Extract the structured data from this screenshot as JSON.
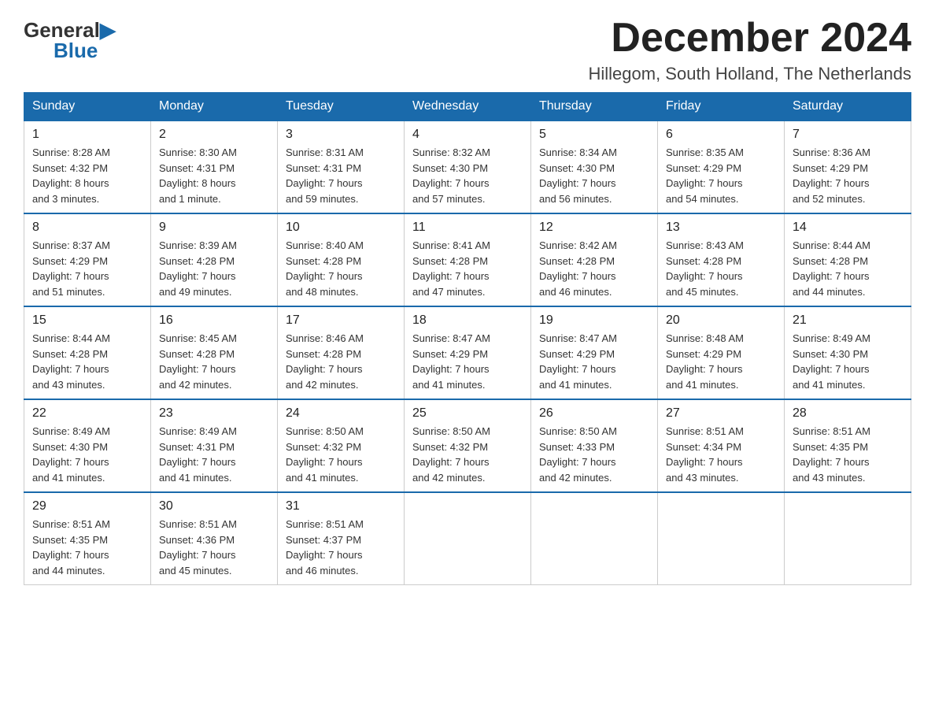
{
  "header": {
    "logo_general": "General",
    "logo_blue": "Blue",
    "month_year": "December 2024",
    "location": "Hillegom, South Holland, The Netherlands"
  },
  "weekdays": [
    "Sunday",
    "Monday",
    "Tuesday",
    "Wednesday",
    "Thursday",
    "Friday",
    "Saturday"
  ],
  "weeks": [
    [
      {
        "day": "1",
        "sunrise": "8:28 AM",
        "sunset": "4:32 PM",
        "daylight": "8 hours and 3 minutes."
      },
      {
        "day": "2",
        "sunrise": "8:30 AM",
        "sunset": "4:31 PM",
        "daylight": "8 hours and 1 minute."
      },
      {
        "day": "3",
        "sunrise": "8:31 AM",
        "sunset": "4:31 PM",
        "daylight": "7 hours and 59 minutes."
      },
      {
        "day": "4",
        "sunrise": "8:32 AM",
        "sunset": "4:30 PM",
        "daylight": "7 hours and 57 minutes."
      },
      {
        "day": "5",
        "sunrise": "8:34 AM",
        "sunset": "4:30 PM",
        "daylight": "7 hours and 56 minutes."
      },
      {
        "day": "6",
        "sunrise": "8:35 AM",
        "sunset": "4:29 PM",
        "daylight": "7 hours and 54 minutes."
      },
      {
        "day": "7",
        "sunrise": "8:36 AM",
        "sunset": "4:29 PM",
        "daylight": "7 hours and 52 minutes."
      }
    ],
    [
      {
        "day": "8",
        "sunrise": "8:37 AM",
        "sunset": "4:29 PM",
        "daylight": "7 hours and 51 minutes."
      },
      {
        "day": "9",
        "sunrise": "8:39 AM",
        "sunset": "4:28 PM",
        "daylight": "7 hours and 49 minutes."
      },
      {
        "day": "10",
        "sunrise": "8:40 AM",
        "sunset": "4:28 PM",
        "daylight": "7 hours and 48 minutes."
      },
      {
        "day": "11",
        "sunrise": "8:41 AM",
        "sunset": "4:28 PM",
        "daylight": "7 hours and 47 minutes."
      },
      {
        "day": "12",
        "sunrise": "8:42 AM",
        "sunset": "4:28 PM",
        "daylight": "7 hours and 46 minutes."
      },
      {
        "day": "13",
        "sunrise": "8:43 AM",
        "sunset": "4:28 PM",
        "daylight": "7 hours and 45 minutes."
      },
      {
        "day": "14",
        "sunrise": "8:44 AM",
        "sunset": "4:28 PM",
        "daylight": "7 hours and 44 minutes."
      }
    ],
    [
      {
        "day": "15",
        "sunrise": "8:44 AM",
        "sunset": "4:28 PM",
        "daylight": "7 hours and 43 minutes."
      },
      {
        "day": "16",
        "sunrise": "8:45 AM",
        "sunset": "4:28 PM",
        "daylight": "7 hours and 42 minutes."
      },
      {
        "day": "17",
        "sunrise": "8:46 AM",
        "sunset": "4:28 PM",
        "daylight": "7 hours and 42 minutes."
      },
      {
        "day": "18",
        "sunrise": "8:47 AM",
        "sunset": "4:29 PM",
        "daylight": "7 hours and 41 minutes."
      },
      {
        "day": "19",
        "sunrise": "8:47 AM",
        "sunset": "4:29 PM",
        "daylight": "7 hours and 41 minutes."
      },
      {
        "day": "20",
        "sunrise": "8:48 AM",
        "sunset": "4:29 PM",
        "daylight": "7 hours and 41 minutes."
      },
      {
        "day": "21",
        "sunrise": "8:49 AM",
        "sunset": "4:30 PM",
        "daylight": "7 hours and 41 minutes."
      }
    ],
    [
      {
        "day": "22",
        "sunrise": "8:49 AM",
        "sunset": "4:30 PM",
        "daylight": "7 hours and 41 minutes."
      },
      {
        "day": "23",
        "sunrise": "8:49 AM",
        "sunset": "4:31 PM",
        "daylight": "7 hours and 41 minutes."
      },
      {
        "day": "24",
        "sunrise": "8:50 AM",
        "sunset": "4:32 PM",
        "daylight": "7 hours and 41 minutes."
      },
      {
        "day": "25",
        "sunrise": "8:50 AM",
        "sunset": "4:32 PM",
        "daylight": "7 hours and 42 minutes."
      },
      {
        "day": "26",
        "sunrise": "8:50 AM",
        "sunset": "4:33 PM",
        "daylight": "7 hours and 42 minutes."
      },
      {
        "day": "27",
        "sunrise": "8:51 AM",
        "sunset": "4:34 PM",
        "daylight": "7 hours and 43 minutes."
      },
      {
        "day": "28",
        "sunrise": "8:51 AM",
        "sunset": "4:35 PM",
        "daylight": "7 hours and 43 minutes."
      }
    ],
    [
      {
        "day": "29",
        "sunrise": "8:51 AM",
        "sunset": "4:35 PM",
        "daylight": "7 hours and 44 minutes."
      },
      {
        "day": "30",
        "sunrise": "8:51 AM",
        "sunset": "4:36 PM",
        "daylight": "7 hours and 45 minutes."
      },
      {
        "day": "31",
        "sunrise": "8:51 AM",
        "sunset": "4:37 PM",
        "daylight": "7 hours and 46 minutes."
      },
      null,
      null,
      null,
      null
    ]
  ]
}
